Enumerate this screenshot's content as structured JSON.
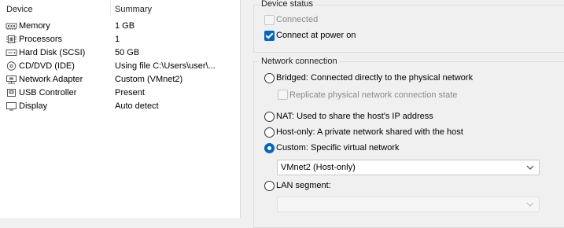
{
  "device_list": {
    "columns": {
      "device": "Device",
      "summary": "Summary"
    },
    "rows": [
      {
        "device": "Memory",
        "summary": "1 GB",
        "icon": "memory-icon"
      },
      {
        "device": "Processors",
        "summary": "1",
        "icon": "processor-icon"
      },
      {
        "device": "Hard Disk (SCSI)",
        "summary": "50 GB",
        "icon": "hard-disk-icon"
      },
      {
        "device": "CD/DVD (IDE)",
        "summary": "Using file C:\\Users\\user\\...",
        "icon": "cd-dvd-icon"
      },
      {
        "device": "Network Adapter",
        "summary": "Custom (VMnet2)",
        "icon": "network-adapter-icon"
      },
      {
        "device": "USB Controller",
        "summary": "Present",
        "icon": "usb-controller-icon"
      },
      {
        "device": "Display",
        "summary": "Auto detect",
        "icon": "display-icon"
      }
    ]
  },
  "device_status": {
    "title": "Device status",
    "connected": {
      "label": "Connected",
      "checked": false,
      "enabled": false
    },
    "connect_at_power_on": {
      "label": "Connect at power on",
      "checked": true,
      "enabled": true
    }
  },
  "network_connection": {
    "title": "Network connection",
    "bridged": {
      "label": "Bridged: Connected directly to the physical network",
      "selected": false
    },
    "replicate_state": {
      "label": "Replicate physical network connection state",
      "checked": false,
      "enabled": false
    },
    "nat": {
      "label": "NAT: Used to share the host's IP address",
      "selected": false
    },
    "host_only": {
      "label": "Host-only: A private network shared with the host",
      "selected": false
    },
    "custom": {
      "label": "Custom: Specific virtual network",
      "selected": true
    },
    "custom_network_value": "VMnet2 (Host-only)",
    "lan_segment": {
      "label": "LAN segment:",
      "selected": false
    },
    "lan_segment_value": ""
  }
}
